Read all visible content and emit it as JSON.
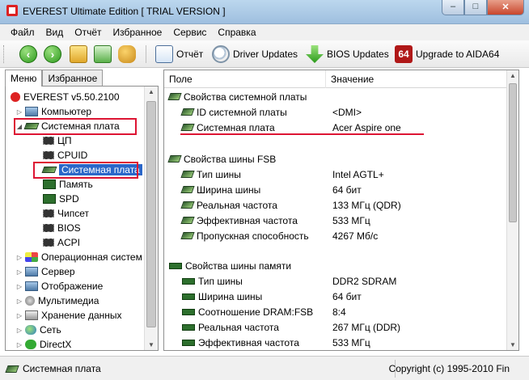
{
  "window": {
    "title": "EVEREST Ultimate Edition  [ TRIAL VERSION ]"
  },
  "menu": [
    "Файл",
    "Вид",
    "Отчёт",
    "Избранное",
    "Сервис",
    "Справка"
  ],
  "toolbar": {
    "report_label": "Отчёт",
    "driver_updates_label": "Driver Updates",
    "bios_updates_label": "BIOS Updates",
    "upgrade_label": "Upgrade to AIDA64",
    "upgrade_badge": "64"
  },
  "tabs": {
    "menu": "Меню",
    "favorites": "Избранное"
  },
  "tree": {
    "root": "EVEREST v5.50.2100",
    "computer": "Компьютер",
    "motherboard_group": "Системная плата",
    "cpu": "ЦП",
    "cpuid": "CPUID",
    "motherboard": "Системная плата",
    "memory": "Память",
    "spd": "SPD",
    "chipset": "Чипсет",
    "bios": "BIOS",
    "acpi": "ACPI",
    "os": "Операционная систем",
    "server": "Сервер",
    "display": "Отображение",
    "multimedia": "Мультимедиа",
    "storage": "Хранение данных",
    "network": "Сеть",
    "directx": "DirectX"
  },
  "columns": {
    "field": "Поле",
    "value": "Значение"
  },
  "sections": {
    "mb_props": {
      "title": "Свойства системной платы",
      "rows": [
        {
          "field": "ID системной платы",
          "value": "<DMI>"
        },
        {
          "field": "Системная плата",
          "value": "Acer Aspire one"
        }
      ]
    },
    "fsb_props": {
      "title": "Свойства шины FSB",
      "rows": [
        {
          "field": "Тип шины",
          "value": "Intel AGTL+"
        },
        {
          "field": "Ширина шины",
          "value": "64 бит"
        },
        {
          "field": "Реальная частота",
          "value": "133 МГц (QDR)"
        },
        {
          "field": "Эффективная частота",
          "value": "533 МГц"
        },
        {
          "field": "Пропускная способность",
          "value": "4267 Мб/с"
        }
      ]
    },
    "mem_props": {
      "title": "Свойства шины памяти",
      "rows": [
        {
          "field": "Тип шины",
          "value": "DDR2 SDRAM"
        },
        {
          "field": "Ширина шины",
          "value": "64 бит"
        },
        {
          "field": "Соотношение DRAM:FSB",
          "value": "8:4"
        },
        {
          "field": "Реальная частота",
          "value": "267 МГц (DDR)"
        },
        {
          "field": "Эффективная частота",
          "value": "533 МГц"
        }
      ]
    }
  },
  "status": {
    "left": "Системная плата",
    "right": "Copyright (c) 1995-2010 Fin"
  },
  "colors": {
    "highlight_red": "#dd1533",
    "selection_blue": "#2a67c9"
  }
}
